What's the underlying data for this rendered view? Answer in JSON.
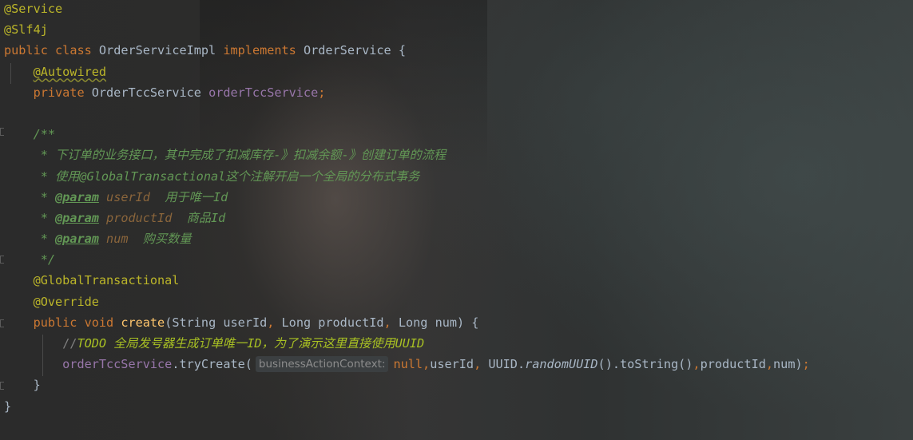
{
  "editor": {
    "language": "java",
    "theme": "darcula"
  },
  "code": {
    "l1": {
      "annotation": "@Service"
    },
    "l2": {
      "annotation": "@Slf4j"
    },
    "l3": {
      "kw_public": "public",
      "kw_class": "class",
      "class_name": "OrderServiceImpl",
      "kw_implements": "implements",
      "interface_name": "OrderService",
      "brace": " {"
    },
    "l4": {
      "annotation": "@Autowired"
    },
    "l5": {
      "kw_private": "private",
      "type": "OrderTccService",
      "field": "orderTccService",
      "semi": ";"
    },
    "l7": {
      "text": "/**"
    },
    "l8": {
      "text": " * 下订单的业务接口，其中完成了扣减库存-》扣减余额-》创建订单的流程"
    },
    "l9": {
      "text": " * 使用@GlobalTransactional这个注解开启一个全局的分布式事务"
    },
    "l10": {
      "star": " * ",
      "tag": "@param",
      "param": "userId",
      "desc": "  用于唯一Id"
    },
    "l11": {
      "star": " * ",
      "tag": "@param",
      "param": "productId",
      "desc": "  商品Id"
    },
    "l12": {
      "star": " * ",
      "tag": "@param",
      "param": "num",
      "desc": "  购买数量"
    },
    "l13": {
      "text": " */"
    },
    "l14": {
      "annotation": "@GlobalTransactional"
    },
    "l15": {
      "annotation": "@Override"
    },
    "l16": {
      "kw_public": "public",
      "kw_void": "void",
      "method": "create",
      "open": "(String userId",
      "comma1": ",",
      "p2": " Long productId",
      "comma2": ",",
      "p3": " Long num) {"
    },
    "l17": {
      "slashes": "//",
      "todo": "TODO 全局发号器生成订单唯一ID，为了演示这里直接使用UUID"
    },
    "l18": {
      "field": "orderTccService",
      "call": ".tryCreate(",
      "hint": "businessActionContext:",
      "null_kw": "null",
      "comma1": ",",
      "arg2": "userId",
      "comma2": ",",
      "arg3a": " UUID.",
      "arg3b": "randomUUID",
      "arg3c": "().toString()",
      "comma3": ",",
      "arg4": "productId",
      "comma4": ",",
      "arg5": "num)",
      "semi": ";"
    },
    "l19": {
      "brace": "}"
    },
    "l20": {
      "brace": "}"
    }
  }
}
